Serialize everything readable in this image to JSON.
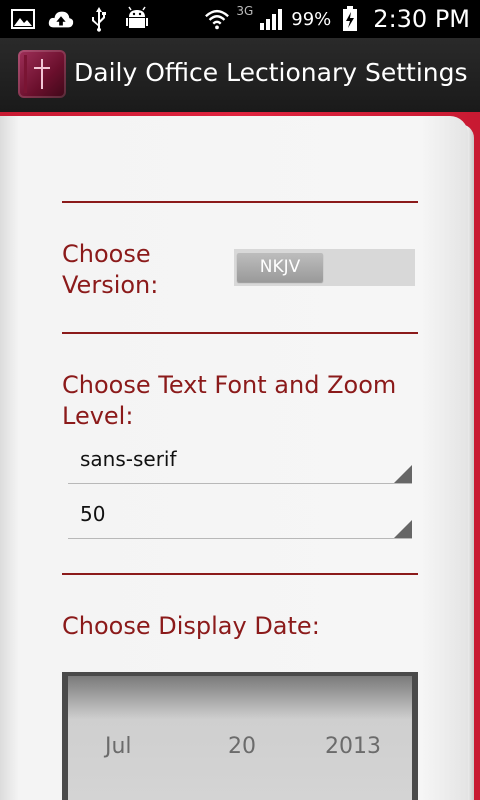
{
  "status_bar": {
    "network": "3G",
    "battery": "99%",
    "time": "2:30 PM"
  },
  "app": {
    "title": "Daily Office Lectionary Settings"
  },
  "settings": {
    "version_label": "Choose Version:",
    "version_value": "NKJV",
    "font_label": "Choose Text Font and Zoom Level:",
    "font_value": "sans-serif",
    "zoom_value": "50",
    "date_label": "Choose Display Date:",
    "date": {
      "month": "Jul",
      "day": "20",
      "year": "2013"
    }
  }
}
